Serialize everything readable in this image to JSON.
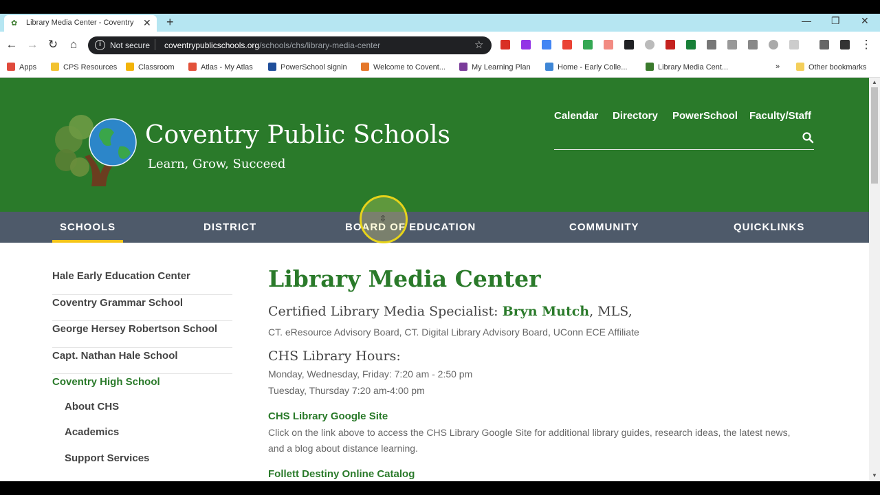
{
  "browser": {
    "tab_title": "Library Media Center - Coventry",
    "new_tab": "+",
    "not_secure": "Not secure",
    "url_host": "coventrypublicschools.org",
    "url_path": "/schools/chs/library-media-center",
    "bookmarks": [
      {
        "label": "Apps",
        "color": "#e04a3c"
      },
      {
        "label": "CPS Resources",
        "color": "#f2c230"
      },
      {
        "label": "Classroom",
        "color": "#f2b40a"
      },
      {
        "label": "Atlas - My Atlas",
        "color": "#e2513a"
      },
      {
        "label": "PowerSchool signin",
        "color": "#1f4e9a"
      },
      {
        "label": "Welcome to Covent...",
        "color": "#e5772a"
      },
      {
        "label": "My Learning Plan",
        "color": "#7a3c9a"
      },
      {
        "label": "Home - Early Colle...",
        "color": "#3e86d6"
      },
      {
        "label": "Library Media Cent...",
        "color": "#3a7a2c"
      }
    ],
    "more_bookmarks": "»",
    "other_bookmarks": "Other bookmarks"
  },
  "header": {
    "title": "Coventry Public Schools",
    "tagline": "Learn, Grow, Succeed",
    "util_links": [
      "Calendar",
      "Directory",
      "PowerSchool",
      "Faculty/Staff"
    ]
  },
  "nav": {
    "items": [
      "SCHOOLS",
      "DISTRICT",
      "BOARD OF EDUCATION",
      "COMMUNITY",
      "QUICKLINKS"
    ]
  },
  "sidebar": {
    "schools": [
      "Hale Early Education Center",
      "Coventry Grammar School",
      "George Hersey Robertson School",
      "Capt. Nathan Hale School",
      "Coventry High School"
    ],
    "subitems": [
      "About CHS",
      "Academics",
      "Support Services"
    ]
  },
  "content": {
    "title": "Library Media Center",
    "specialist_label": "Certified Library Media Specialist: ",
    "specialist_name": "Bryn Mutch",
    "specialist_suffix": ", MLS,",
    "affiliations": "CT. eResource Advisory Board, CT. Digital Library Advisory Board, UConn ECE Affiliate",
    "hours_title": "CHS Library Hours:",
    "hours_1": "Monday, Wednesday, Friday: 7:20 am - 2:50 pm",
    "hours_2": "Tuesday, Thursday 7:20 am-4:00 pm",
    "google_site_link": "CHS Library Google Site",
    "google_site_desc": "Click on the link above to access the CHS Library Google Site for additional library guides, research ideas, the latest news, and a blog about distance learning.",
    "follett_link": "Follett Destiny Online Catalog"
  }
}
